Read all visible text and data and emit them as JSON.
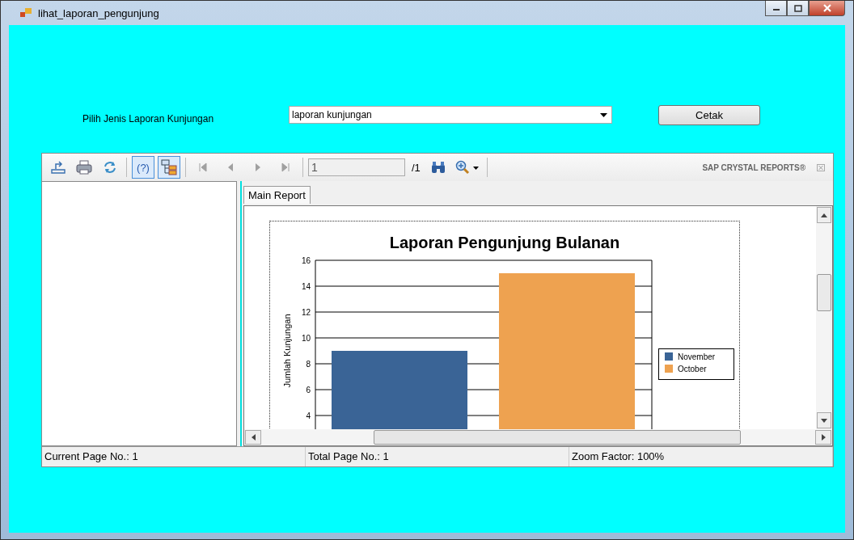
{
  "window": {
    "title": "lihat_laporan_pengunjung"
  },
  "form": {
    "label": "Pilih Jenis Laporan Kunjungan",
    "report_type": {
      "value": "laporan kunjungan"
    },
    "print_button": "Cetak"
  },
  "viewer": {
    "tools": [
      {
        "kind": "export",
        "pressed": false
      },
      {
        "kind": "print",
        "pressed": false
      },
      {
        "kind": "refresh",
        "pressed": false
      },
      {
        "kind": "help",
        "pressed": true,
        "label": "(?)"
      },
      {
        "kind": "tree",
        "pressed": true
      }
    ],
    "nav": [
      {
        "kind": "first",
        "disabled": true
      },
      {
        "kind": "prev",
        "disabled": true
      },
      {
        "kind": "next",
        "disabled": true
      },
      {
        "kind": "last",
        "disabled": true
      }
    ],
    "page_field": {
      "value": "1"
    },
    "page_total": "/1",
    "brand": "SAP CRYSTAL REPORTS®",
    "tabs": [
      {
        "label": "Main Report",
        "selected": true
      }
    ],
    "chart_data": {
      "type": "bar",
      "title": "Laporan Pengunjung Bulanan",
      "ylabel": "Jumlah Kunjungan",
      "yticks": [
        4,
        6,
        8,
        10,
        12,
        14,
        16
      ],
      "ylim": [
        0,
        16
      ],
      "grid": true,
      "legend": true,
      "series": [
        {
          "name": "November",
          "color": "#3a6496",
          "values": [
            9
          ]
        },
        {
          "name": "October",
          "color": "#eea250",
          "values": [
            15
          ]
        }
      ]
    }
  },
  "status_bar": [
    "Current Page No.: 1",
    "Total Page No.: 1",
    "Zoom Factor: 100%"
  ]
}
